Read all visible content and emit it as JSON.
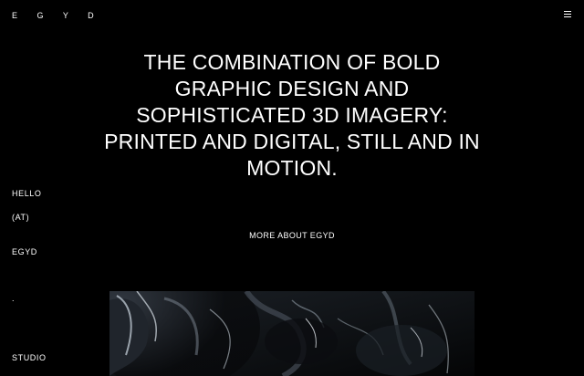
{
  "header": {
    "logo": "E G Y D",
    "menu_icon": "hamburger-icon"
  },
  "main": {
    "headline": "THE COMBINATION OF BOLD GRAPHIC DESIGN AND SOPHISTICATED 3D IMAGERY: PRINTED AND DIGITAL, STILL AND IN MOTION.",
    "more_link": "MORE ABOUT EGYD",
    "hero_image": "abstract dark glossy 3D render"
  },
  "sidebar": {
    "contact": [
      "HELLO",
      "(AT)",
      "EGYD",
      ".",
      "STUDIO"
    ]
  },
  "colors": {
    "background": "#000000",
    "text": "#ffffff"
  }
}
